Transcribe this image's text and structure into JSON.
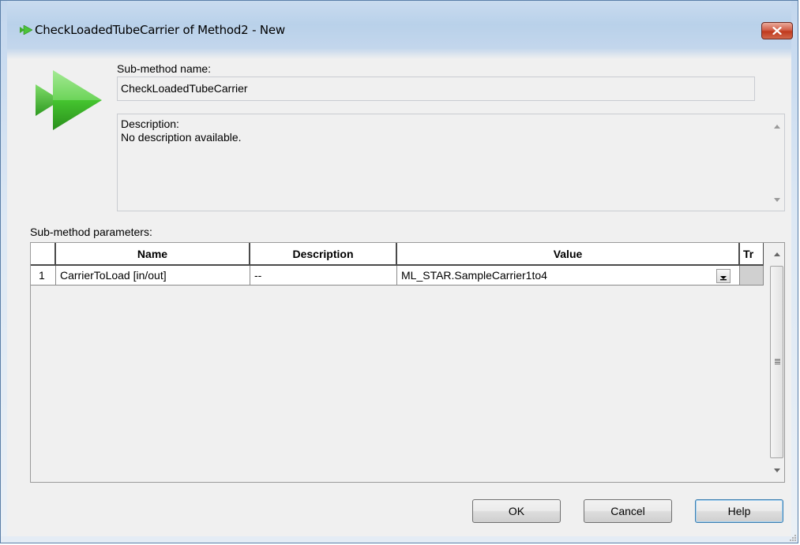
{
  "window": {
    "title": "CheckLoadedTubeCarrier of Method2 - New",
    "close_icon": "close-x-icon"
  },
  "sub_method": {
    "name_label": "Sub-method name:",
    "name_value": "CheckLoadedTubeCarrier",
    "description_label": "Description:",
    "description_value": "No description available."
  },
  "parameters": {
    "label": "Sub-method parameters:",
    "columns": [
      "Name",
      "Description",
      "Value",
      "Tr"
    ],
    "rows": [
      {
        "index": "1",
        "name": "CarrierToLoad [in/out]",
        "description": "--",
        "value": "ML_STAR.SampleCarrier1to4",
        "tr": ""
      }
    ]
  },
  "buttons": {
    "ok": "OK",
    "cancel": "Cancel",
    "help": "Help"
  },
  "colors": {
    "accent_green": "#3fae2a",
    "close_red": "#c0391d",
    "default_button_border": "#3c7fb1"
  }
}
